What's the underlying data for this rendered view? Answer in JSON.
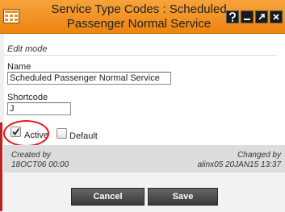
{
  "window": {
    "title": "Service Type Codes : Scheduled Passenger Normal Service",
    "title_line1": "Service Type Codes : Scheduled",
    "title_line2": "Passenger Normal Service",
    "buttons": [
      "help-icon",
      "minimize-icon",
      "maximize-icon",
      "close-icon"
    ]
  },
  "form": {
    "mode": "Edit mode",
    "name_label": "Name",
    "name_value": "Scheduled Passenger Normal Service",
    "shortcode_label": "Shortcode",
    "shortcode_value": "J",
    "active_label": "Active",
    "active_checked": true,
    "default_label": "Default",
    "default_checked": false
  },
  "audit": {
    "created_label": "Created by",
    "created_value": "18OCT06 00:00",
    "changed_label": "Changed by",
    "changed_value": "alinx05 20JAN15 13:37"
  },
  "actions": {
    "cancel_label": "Cancel",
    "save_label": "Save"
  },
  "colors": {
    "titlebar": "#f09020",
    "annotation_circle": "#e8141a",
    "button_bg": "#4a4a4a"
  }
}
